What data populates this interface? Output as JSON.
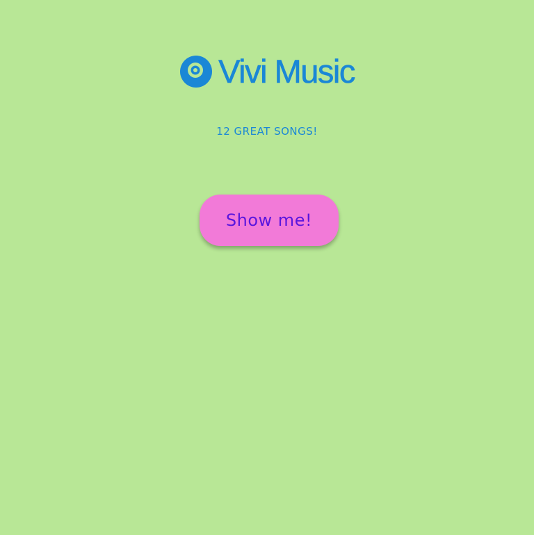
{
  "brand": {
    "name": "Vivi Music",
    "icon": "vinyl-disc-icon",
    "color": "#1a87d6"
  },
  "tagline": "12 GREAT SONGS!",
  "cta": {
    "label": "Show me!",
    "background": "#f27ad8",
    "text_color": "#5a16de"
  },
  "page": {
    "background": "#b8e796"
  }
}
